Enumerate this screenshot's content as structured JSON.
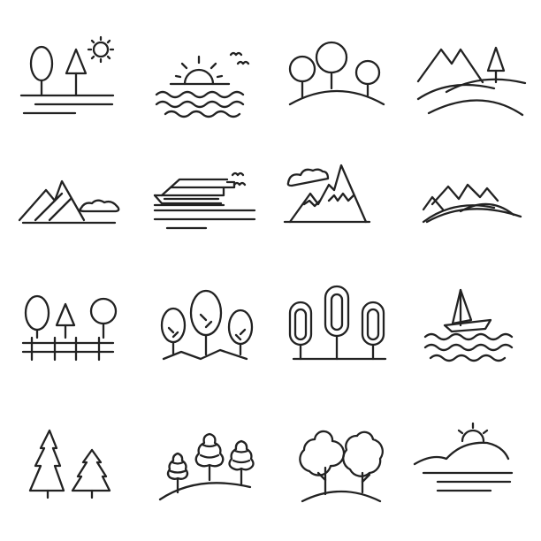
{
  "colors": {
    "stroke": "#222222",
    "background": "#ffffff"
  },
  "icons": [
    {
      "name": "trees-sun-lake-icon"
    },
    {
      "name": "sunset-sea-birds-icon"
    },
    {
      "name": "trees-on-hill-icon"
    },
    {
      "name": "mountains-hills-tree-icon"
    },
    {
      "name": "mountains-cloud-icon"
    },
    {
      "name": "cruise-ship-icon"
    },
    {
      "name": "snowy-mountains-cloud-icon"
    },
    {
      "name": "mountain-range-hills-icon"
    },
    {
      "name": "trees-fence-icon"
    },
    {
      "name": "forest-trees-icon"
    },
    {
      "name": "tall-trees-icon"
    },
    {
      "name": "sailboat-waves-icon"
    },
    {
      "name": "fir-trees-icon"
    },
    {
      "name": "bush-trees-hills-icon"
    },
    {
      "name": "round-trees-hill-icon"
    },
    {
      "name": "sunset-hill-lake-icon"
    }
  ]
}
